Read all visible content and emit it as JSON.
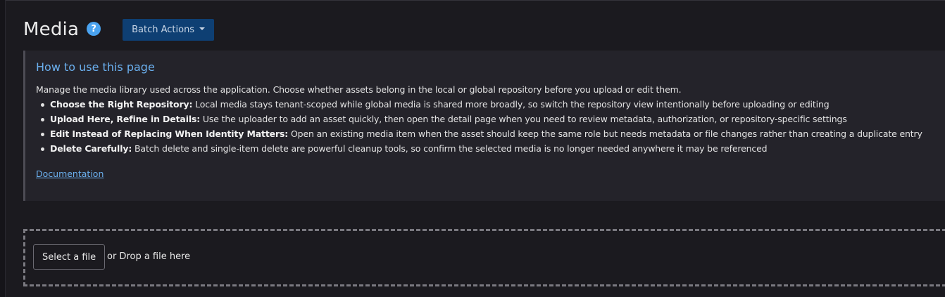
{
  "header": {
    "title": "Media",
    "help_icon": "?",
    "batch_actions_label": "Batch Actions"
  },
  "info": {
    "title": "How to use this page",
    "description": "Manage the media library used across the application. Choose whether assets belong in the local or global repository before you upload or edit them.",
    "items": [
      {
        "heading": "Choose the Right Repository:",
        "text": " Local media stays tenant-scoped while global media is shared more broadly, so switch the repository view intentionally before uploading or editing"
      },
      {
        "heading": "Upload Here, Refine in Details:",
        "text": " Use the uploader to add an asset quickly, then open the detail page when you need to review metadata, authorization, or repository-specific settings"
      },
      {
        "heading": "Edit Instead of Replacing When Identity Matters:",
        "text": " Open an existing media item when the asset should keep the same role but needs metadata or file changes rather than creating a duplicate entry"
      },
      {
        "heading": "Delete Carefully:",
        "text": " Batch delete and single-item delete are powerful cleanup tools, so confirm the selected media is no longer needed anywhere it may be referenced"
      }
    ],
    "documentation_link": "Documentation"
  },
  "upload": {
    "select_label": "Select a file",
    "drop_text": "or Drop a file here"
  },
  "colors": {
    "background": "#1b1a1f",
    "accent": "#6bb0ef",
    "batch_button": "#0e3f73",
    "help_icon": "#4aa3f0"
  }
}
